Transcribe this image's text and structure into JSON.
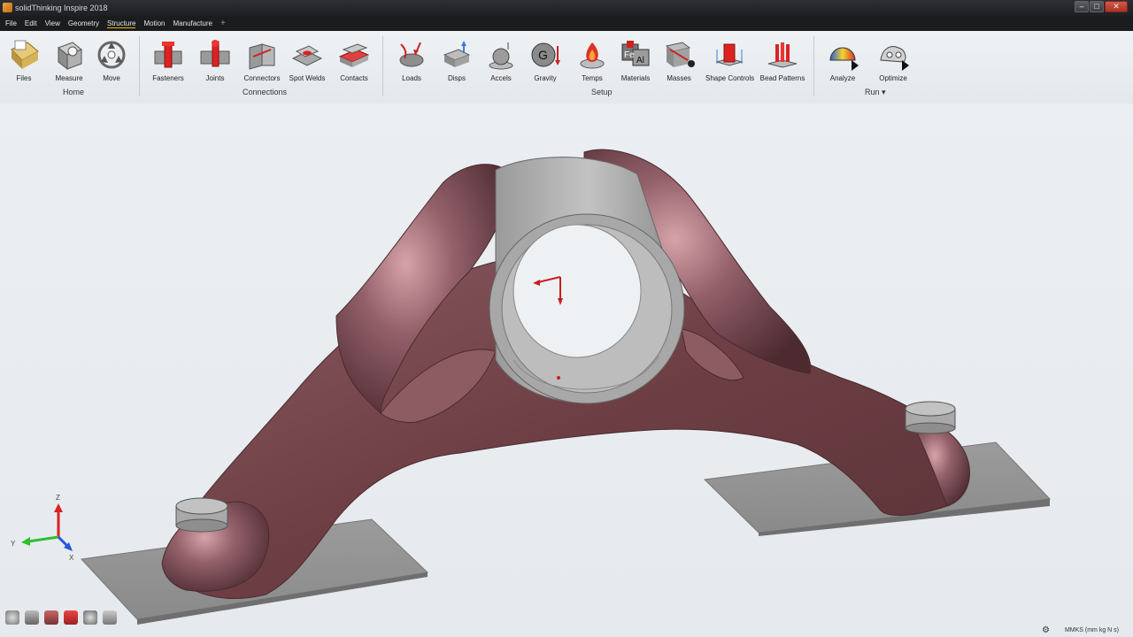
{
  "window": {
    "title": "solidThinking Inspire 2018"
  },
  "window_controls": {
    "minimize": "–",
    "maximize": "□",
    "close": "✕"
  },
  "menu": {
    "items": [
      "File",
      "Edit",
      "View",
      "Geometry",
      "Structure",
      "Motion",
      "Manufacture"
    ],
    "active": "Structure",
    "add": "+"
  },
  "ribbon": {
    "groups": {
      "home": "Home",
      "connections": "Connections",
      "setup": "Setup",
      "run": "Run ▾"
    },
    "tools": {
      "files": "Files",
      "measure": "Measure",
      "move": "Move",
      "fasteners": "Fasteners",
      "joints": "Joints",
      "connectors": "Connectors",
      "spot_welds": "Spot Welds",
      "contacts": "Contacts",
      "loads": "Loads",
      "disps": "Disps",
      "accels": "Accels",
      "gravity": "Gravity",
      "temps": "Temps",
      "materials": "Materials",
      "masses": "Masses",
      "shape_controls": "Shape Controls",
      "bead_patterns": "Bead Patterns",
      "analyze": "Analyze",
      "optimize": "Optimize"
    }
  },
  "triad": {
    "z": "Z",
    "y": "Y",
    "x": "X"
  },
  "status": {
    "units": "MMKS (mm kg N s)"
  },
  "colors": {
    "part": "#7a4b50",
    "metal": "#9c9c9c",
    "accent_red": "#c81e1e",
    "menu_active": "#f0b400"
  }
}
